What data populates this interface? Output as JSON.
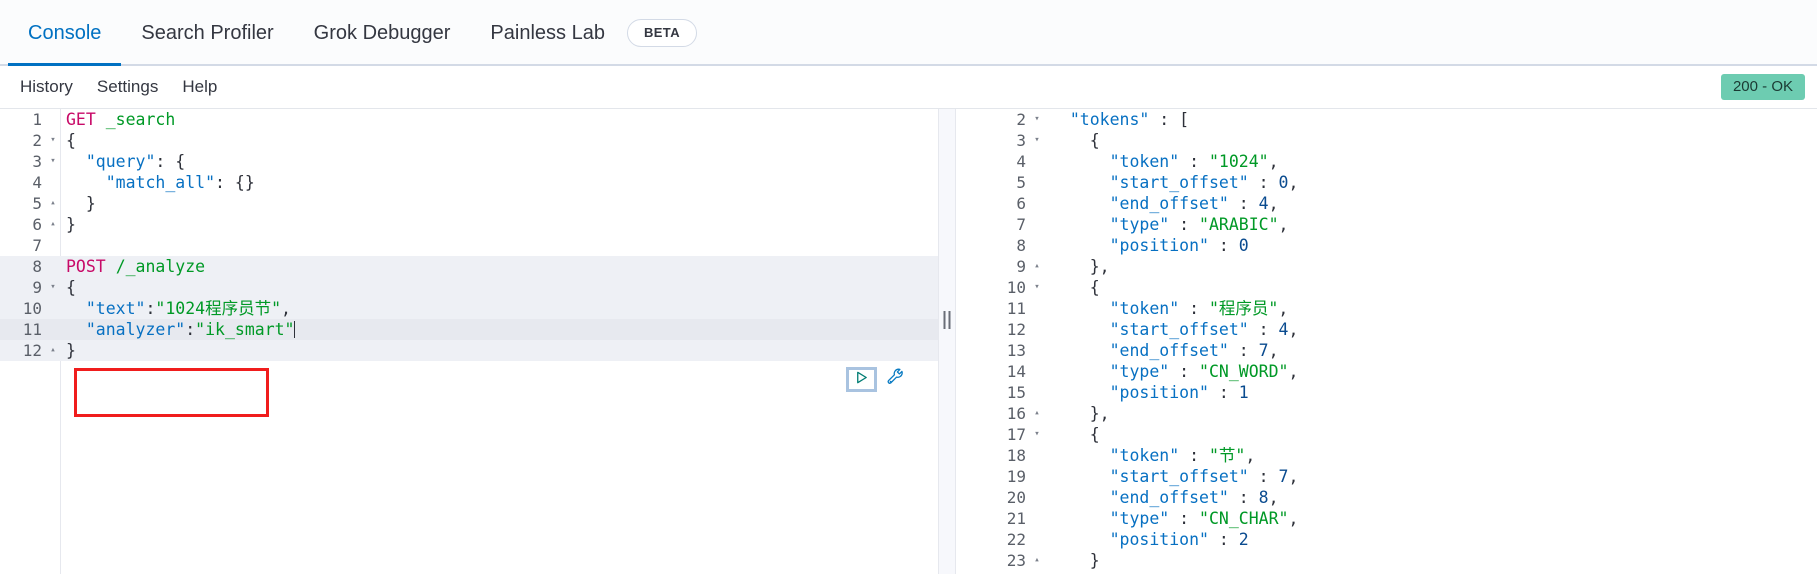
{
  "app": {
    "tabs": [
      {
        "label": "Console",
        "active": true
      },
      {
        "label": "Search Profiler",
        "active": false
      },
      {
        "label": "Grok Debugger",
        "active": false
      },
      {
        "label": "Painless Lab",
        "active": false
      }
    ],
    "beta_badge": "BETA"
  },
  "subnav": {
    "items": [
      "History",
      "Settings",
      "Help"
    ],
    "status_badge": "200 - OK",
    "status_badge_color": "#6dccb1"
  },
  "editor": {
    "play_icon": "play-icon",
    "wrench_icon": "wrench-icon",
    "lines": [
      {
        "n": "1",
        "fold": "",
        "text": "GET _search"
      },
      {
        "n": "2",
        "fold": "▾",
        "text": "{"
      },
      {
        "n": "3",
        "fold": "▾",
        "text": "  \"query\": {"
      },
      {
        "n": "4",
        "fold": "",
        "text": "    \"match_all\": {}"
      },
      {
        "n": "5",
        "fold": "▴",
        "text": "  }"
      },
      {
        "n": "6",
        "fold": "▴",
        "text": "}"
      },
      {
        "n": "7",
        "fold": "",
        "text": ""
      },
      {
        "n": "8",
        "fold": "",
        "text": "POST /_analyze"
      },
      {
        "n": "9",
        "fold": "▾",
        "text": "{"
      },
      {
        "n": "10",
        "fold": "",
        "text": "  \"text\":\"1024程序员节\","
      },
      {
        "n": "11",
        "fold": "",
        "text": "  \"analyzer\":\"ik_smart\""
      },
      {
        "n": "12",
        "fold": "▴",
        "text": "}"
      }
    ]
  },
  "response": {
    "lines": [
      {
        "n": "2",
        "fold": "▾",
        "text": "  \"tokens\" : ["
      },
      {
        "n": "3",
        "fold": "▾",
        "text": "    {"
      },
      {
        "n": "4",
        "fold": "",
        "text": "      \"token\" : \"1024\","
      },
      {
        "n": "5",
        "fold": "",
        "text": "      \"start_offset\" : 0,"
      },
      {
        "n": "6",
        "fold": "",
        "text": "      \"end_offset\" : 4,"
      },
      {
        "n": "7",
        "fold": "",
        "text": "      \"type\" : \"ARABIC\","
      },
      {
        "n": "8",
        "fold": "",
        "text": "      \"position\" : 0"
      },
      {
        "n": "9",
        "fold": "▴",
        "text": "    },"
      },
      {
        "n": "10",
        "fold": "▾",
        "text": "    {"
      },
      {
        "n": "11",
        "fold": "",
        "text": "      \"token\" : \"程序员\","
      },
      {
        "n": "12",
        "fold": "",
        "text": "      \"start_offset\" : 4,"
      },
      {
        "n": "13",
        "fold": "",
        "text": "      \"end_offset\" : 7,"
      },
      {
        "n": "14",
        "fold": "",
        "text": "      \"type\" : \"CN_WORD\","
      },
      {
        "n": "15",
        "fold": "",
        "text": "      \"position\" : 1"
      },
      {
        "n": "16",
        "fold": "▴",
        "text": "    },"
      },
      {
        "n": "17",
        "fold": "▾",
        "text": "    {"
      },
      {
        "n": "18",
        "fold": "",
        "text": "      \"token\" : \"节\","
      },
      {
        "n": "19",
        "fold": "",
        "text": "      \"start_offset\" : 7,"
      },
      {
        "n": "20",
        "fold": "",
        "text": "      \"end_offset\" : 8,"
      },
      {
        "n": "21",
        "fold": "",
        "text": "      \"type\" : \"CN_CHAR\","
      },
      {
        "n": "22",
        "fold": "",
        "text": "      \"position\" : 2"
      },
      {
        "n": "23",
        "fold": "▴",
        "text": "    }"
      }
    ]
  },
  "annotations": {
    "request_box": "highlight-request-body",
    "token_box_1": "highlight-token-chengxuyuan",
    "token_box_2": "highlight-token-jie",
    "color": "#f01d1d"
  }
}
